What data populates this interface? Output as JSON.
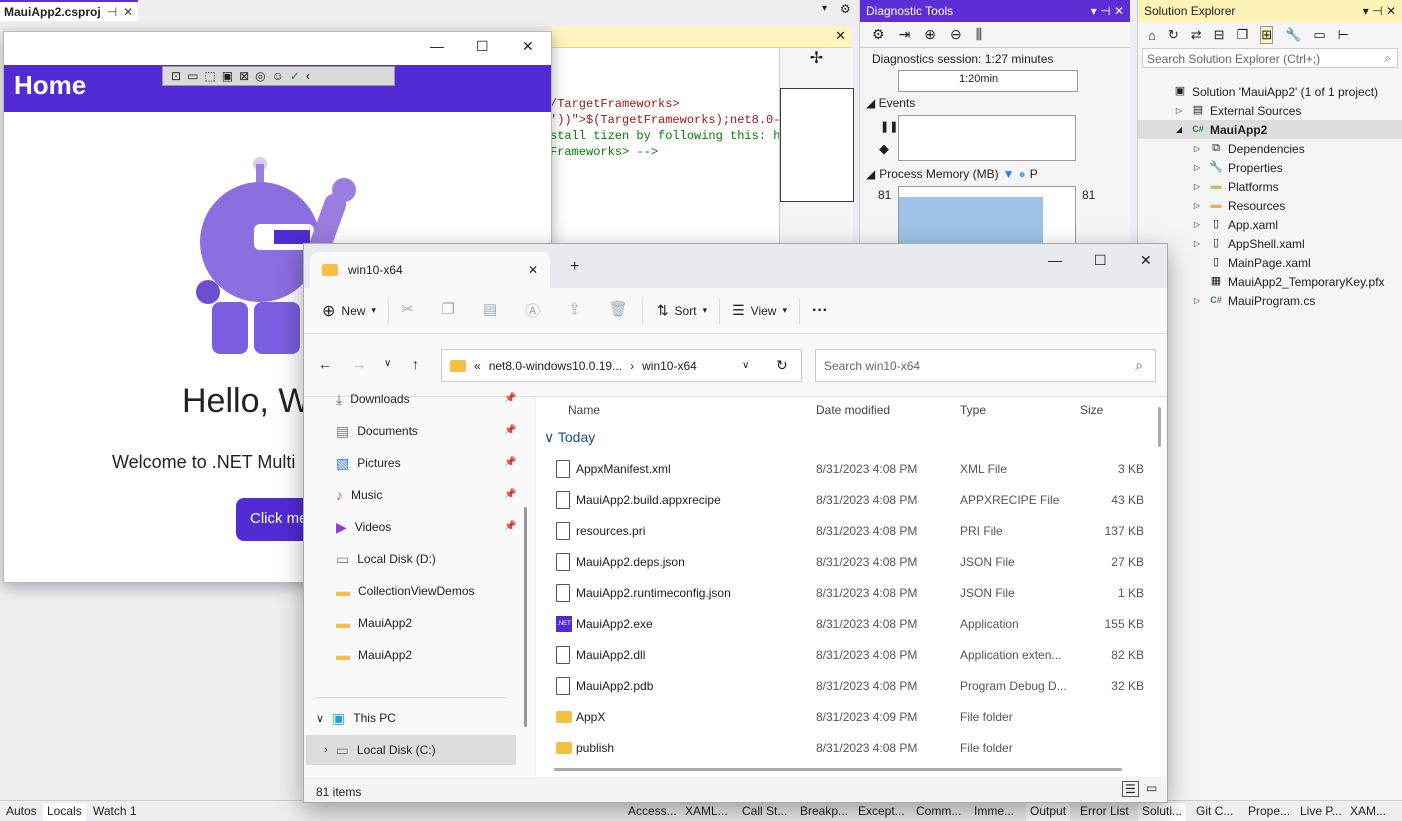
{
  "vs": {
    "doc_tab": "MauiApp2.csproj",
    "editor_lines": [
      "/TargetFrameworks>",
      "'))\">$(TargetFrameworks);net8.0-",
      "stall tizen by following this: h",
      "Frameworks> -->"
    ],
    "diag": {
      "title": "Diagnostic Tools",
      "session": "Diagnostics session: 1:27 minutes",
      "time": "1:20min",
      "events": "Events",
      "memory": "Process Memory (MB)",
      "memory_p": "P",
      "mem_left": "81",
      "mem_right": "81"
    },
    "sol": {
      "title": "Solution Explorer",
      "search": "Search Solution Explorer (Ctrl+;)",
      "items": [
        {
          "label": "Solution 'MauiApp2' (1 of 1 project)",
          "icon": "solution-icon"
        },
        {
          "label": "External Sources",
          "icon": "external-icon"
        },
        {
          "label": "MauiApp2",
          "icon": "csharp-project-icon"
        },
        {
          "label": "Dependencies",
          "icon": "dependencies-icon"
        },
        {
          "label": "Properties",
          "icon": "properties-icon"
        },
        {
          "label": "Platforms",
          "icon": "folder-icon"
        },
        {
          "label": "Resources",
          "icon": "folder-icon"
        },
        {
          "label": "App.xaml",
          "icon": "xaml-icon"
        },
        {
          "label": "AppShell.xaml",
          "icon": "xaml-icon"
        },
        {
          "label": "MainPage.xaml",
          "icon": "xaml-icon"
        },
        {
          "label": "MauiApp2_TemporaryKey.pfx",
          "icon": "certificate-icon"
        },
        {
          "label": "MauiProgram.cs",
          "icon": "csharp-file-icon"
        }
      ]
    },
    "bottom_left": [
      "Autos",
      "Locals",
      "Watch 1"
    ],
    "bottom_right": [
      "Access...",
      "XAML...",
      "Call St...",
      "Breakp...",
      "Except...",
      "Comm...",
      "Imme...",
      "Output",
      "Error List",
      "Soluti...",
      "Git C...",
      "Prope...",
      "Live P...",
      "XAM..."
    ]
  },
  "maui": {
    "title": "Home",
    "hello": "Hello, W",
    "welcome": "Welcome to .NET Multi",
    "button": "Click me"
  },
  "explorer": {
    "tab": "win10-x64",
    "new": "New",
    "sort": "Sort",
    "view": "View",
    "more": "···",
    "breadcrumb_root": "«",
    "breadcrumb_1": "net8.0-windows10.0.19...",
    "breadcrumb_2": "win10-x64",
    "search": "Search win10-x64",
    "nav": [
      {
        "label": "Downloads",
        "icon": "download-icon",
        "pinned": true
      },
      {
        "label": "Documents",
        "icon": "documents-icon",
        "pinned": true
      },
      {
        "label": "Pictures",
        "icon": "pictures-icon",
        "pinned": true
      },
      {
        "label": "Music",
        "icon": "music-icon",
        "pinned": true
      },
      {
        "label": "Videos",
        "icon": "videos-icon",
        "pinned": true
      },
      {
        "label": "Local Disk (D:)",
        "icon": "drive-icon",
        "pinned": false
      },
      {
        "label": "CollectionViewDemos",
        "icon": "folder-icon",
        "pinned": false
      },
      {
        "label": "MauiApp2",
        "icon": "folder-icon",
        "pinned": false
      },
      {
        "label": "MauiApp2",
        "icon": "folder-icon",
        "pinned": false
      },
      {
        "label": "This PC",
        "icon": "pc-icon",
        "pinned": false
      },
      {
        "label": "Local Disk (C:)",
        "icon": "drive-icon",
        "pinned": false
      }
    ],
    "columns": [
      "Name",
      "Date modified",
      "Type",
      "Size"
    ],
    "group": "Today",
    "files": [
      {
        "name": "AppxManifest.xml",
        "date": "8/31/2023 4:08 PM",
        "type": "XML File",
        "size": "3 KB",
        "kind": "file"
      },
      {
        "name": "MauiApp2.build.appxrecipe",
        "date": "8/31/2023 4:08 PM",
        "type": "APPXRECIPE File",
        "size": "43 KB",
        "kind": "file"
      },
      {
        "name": "resources.pri",
        "date": "8/31/2023 4:08 PM",
        "type": "PRI File",
        "size": "137 KB",
        "kind": "file"
      },
      {
        "name": "MauiApp2.deps.json",
        "date": "8/31/2023 4:08 PM",
        "type": "JSON File",
        "size": "27 KB",
        "kind": "file"
      },
      {
        "name": "MauiApp2.runtimeconfig.json",
        "date": "8/31/2023 4:08 PM",
        "type": "JSON File",
        "size": "1 KB",
        "kind": "file"
      },
      {
        "name": "MauiApp2.exe",
        "date": "8/31/2023 4:08 PM",
        "type": "Application",
        "size": "155 KB",
        "kind": "exe"
      },
      {
        "name": "MauiApp2.dll",
        "date": "8/31/2023 4:08 PM",
        "type": "Application exten...",
        "size": "82 KB",
        "kind": "file"
      },
      {
        "name": "MauiApp2.pdb",
        "date": "8/31/2023 4:08 PM",
        "type": "Program Debug D...",
        "size": "32 KB",
        "kind": "file"
      },
      {
        "name": "AppX",
        "date": "8/31/2023 4:09 PM",
        "type": "File folder",
        "size": "",
        "kind": "folder"
      },
      {
        "name": "publish",
        "date": "8/31/2023 4:08 PM",
        "type": "File folder",
        "size": "",
        "kind": "folder"
      }
    ],
    "status": "81 items"
  }
}
